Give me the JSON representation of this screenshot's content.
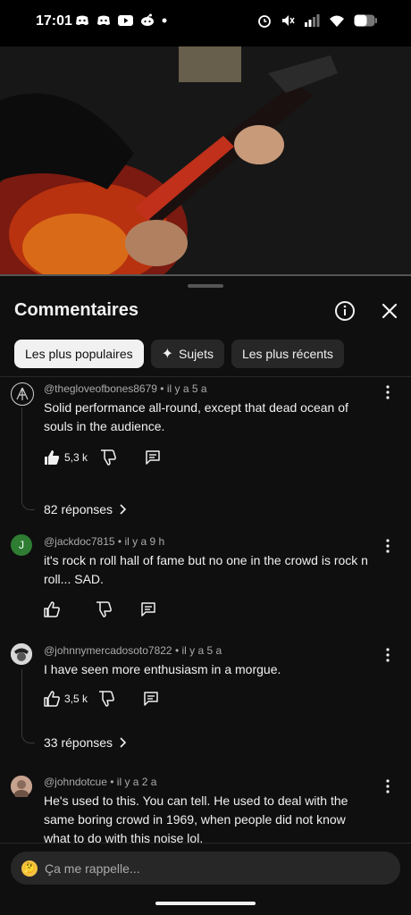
{
  "status_bar": {
    "time": "17:01",
    "left_icons": [
      "discord-icon",
      "discord-icon",
      "youtube-icon",
      "reddit-icon",
      "dot-icon"
    ],
    "right_icons": [
      "alarm-icon",
      "mute-icon",
      "signal-icon",
      "wifi-icon",
      "battery-icon"
    ]
  },
  "video": {
    "description_icon": "guitar-video-frame"
  },
  "sheet": {
    "title": "Commentaires",
    "chips": [
      {
        "label": "Les plus populaires",
        "active": true
      },
      {
        "label": "Sujets",
        "icon": "sparkle-icon"
      },
      {
        "label": "Les plus récents"
      }
    ]
  },
  "comments": [
    {
      "handle": "@thegloveofbones8679",
      "time": "il y a 5 a",
      "text": "Solid performance all-round, except that dead ocean of souls in the audience.",
      "likes": "5,3 k",
      "liked": true,
      "replies": "82 réponses"
    },
    {
      "avatar_letter": "J",
      "handle": "@jackdoc7815",
      "time": "il y a 9 h",
      "text": "it's rock n roll hall of fame but no one in the crowd is rock n roll... SAD.",
      "likes": ""
    },
    {
      "handle": "@johnnymercadosoto7822",
      "time": "il y a 5 a",
      "text": "I have seen more enthusiasm in a morgue.",
      "likes": "3,5 k",
      "replies": "33 réponses"
    },
    {
      "handle": "@johndotcue",
      "time": "il y a 2 a",
      "text": "He's used to this. You can tell. He used to deal with the same boring crowd in 1969, when people did not know what to do with this noise lol."
    }
  ],
  "input": {
    "placeholder": "Ça me rappelle..."
  },
  "colors": {
    "accent_green": "#2e7d32",
    "background": "#0f0f0f",
    "chip": "#272727"
  }
}
